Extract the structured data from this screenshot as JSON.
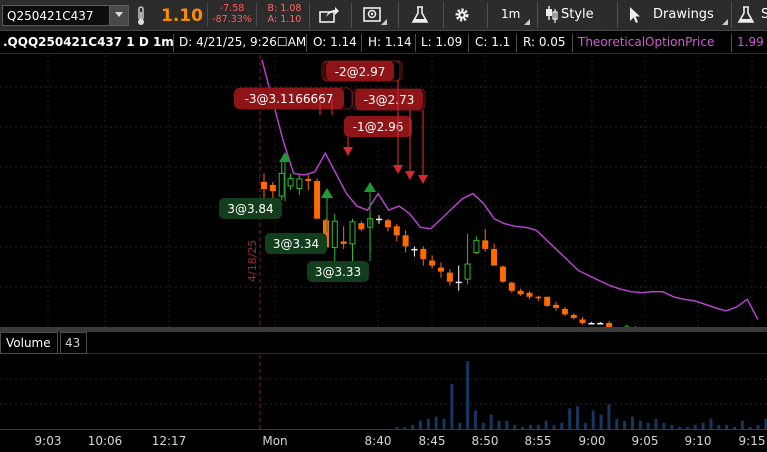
{
  "toolbar": {
    "symbol": "Q250421C437",
    "last_price": "1.10",
    "net_change": "-7.58",
    "pct_change": "-87.33%",
    "bid": "B: 1.08",
    "ask": "A: 1.10",
    "timeframe_label": "1m",
    "style_label": "Style",
    "drawings_label": "Drawings",
    "studies_label_partial": "S"
  },
  "infobar": {
    "title": ".QQQ250421C437 1 D 1m",
    "date": "D: 4/21/25, 9:26☐AM",
    "open": "O: 1.14",
    "high": "H: 1.14",
    "low": "L: 1.09",
    "close": "C: 1.1",
    "range": "R: 0.05",
    "study_name": "TheoreticalOptionPrice",
    "study_value": "1.99"
  },
  "colors": {
    "up": "#2dbb2d",
    "down": "#ff6a00",
    "neutral": "#ffffff",
    "theoretical_line": "#c044d6",
    "sell_label_bg": "#8e1417",
    "buy_label_bg": "#123e1e",
    "volume_bar": "#15375f"
  },
  "date_marker": "4/18/25",
  "trade_labels": [
    {
      "text": "-2@2.97",
      "side": "sell"
    },
    {
      "text": "-3@3.1166667",
      "side": "sell"
    },
    {
      "text": "-3@2.73",
      "side": "sell"
    },
    {
      "text": "-1@2.96",
      "side": "sell"
    },
    {
      "text": "3@3.84",
      "side": "buy"
    },
    {
      "text": "3@3.34",
      "side": "buy"
    },
    {
      "text": "3@3.33",
      "side": "buy"
    }
  ],
  "volume": {
    "label": "Volume",
    "value": "43"
  },
  "time_axis": [
    "9:03",
    "10:06",
    "12:17",
    "Mon",
    "8:40",
    "8:45",
    "8:50",
    "8:55",
    "9:00",
    "9:05",
    "9:10",
    "9:15"
  ],
  "chart_data": {
    "type": "candlestick",
    "price_range": [
      0.9,
      6.3
    ],
    "candles": [
      {
        "o": 3.78,
        "h": 3.95,
        "l": 3.45,
        "c": 3.64
      },
      {
        "o": 3.72,
        "h": 3.78,
        "l": 3.45,
        "c": 3.6
      },
      {
        "o": 3.5,
        "h": 4.18,
        "l": 3.42,
        "c": 3.95
      },
      {
        "o": 3.7,
        "h": 3.95,
        "l": 3.62,
        "c": 3.85
      },
      {
        "o": 3.65,
        "h": 3.92,
        "l": 3.52,
        "c": 3.84
      },
      {
        "o": 3.84,
        "h": 3.92,
        "l": 3.62,
        "c": 3.8
      },
      {
        "o": 3.8,
        "h": 3.85,
        "l": 3.05,
        "c": 3.05
      },
      {
        "o": 3.02,
        "h": 3.05,
        "l": 2.4,
        "c": 2.48
      },
      {
        "o": 2.48,
        "h": 3.15,
        "l": 2.1,
        "c": 3.0
      },
      {
        "o": 2.6,
        "h": 2.9,
        "l": 2.45,
        "c": 2.55
      },
      {
        "o": 2.55,
        "h": 3.05,
        "l": 2.2,
        "c": 2.99
      },
      {
        "o": 2.96,
        "h": 3.0,
        "l": 2.8,
        "c": 2.84
      },
      {
        "o": 2.88,
        "h": 3.1,
        "l": 2.4,
        "c": 3.05
      },
      {
        "o": 3.05,
        "h": 3.12,
        "l": 2.95,
        "c": 3.05
      },
      {
        "o": 3.02,
        "h": 3.05,
        "l": 2.8,
        "c": 2.88
      },
      {
        "o": 2.9,
        "h": 2.95,
        "l": 2.6,
        "c": 2.72
      },
      {
        "o": 2.72,
        "h": 2.82,
        "l": 2.38,
        "c": 2.5
      },
      {
        "o": 2.45,
        "h": 2.5,
        "l": 2.3,
        "c": 2.45
      },
      {
        "o": 2.45,
        "h": 2.5,
        "l": 2.12,
        "c": 2.25
      },
      {
        "o": 2.22,
        "h": 2.32,
        "l": 2.06,
        "c": 2.12
      },
      {
        "o": 2.08,
        "h": 2.18,
        "l": 1.88,
        "c": 2.0
      },
      {
        "o": 1.98,
        "h": 2.05,
        "l": 1.72,
        "c": 1.8
      },
      {
        "o": 1.8,
        "h": 2.12,
        "l": 1.62,
        "c": 1.8
      },
      {
        "o": 1.85,
        "h": 2.75,
        "l": 1.75,
        "c": 2.15
      },
      {
        "o": 2.38,
        "h": 2.7,
        "l": 2.35,
        "c": 2.62
      },
      {
        "o": 2.62,
        "h": 2.85,
        "l": 2.4,
        "c": 2.45
      },
      {
        "o": 2.45,
        "h": 2.55,
        "l": 2.12,
        "c": 2.12
      },
      {
        "o": 2.1,
        "h": 2.12,
        "l": 1.78,
        "c": 1.8
      },
      {
        "o": 1.78,
        "h": 1.8,
        "l": 1.58,
        "c": 1.62
      },
      {
        "o": 1.62,
        "h": 1.66,
        "l": 1.52,
        "c": 1.55
      },
      {
        "o": 1.58,
        "h": 1.62,
        "l": 1.45,
        "c": 1.5
      },
      {
        "o": 1.5,
        "h": 1.52,
        "l": 1.42,
        "c": 1.48
      },
      {
        "o": 1.5,
        "h": 1.5,
        "l": 1.3,
        "c": 1.32
      },
      {
        "o": 1.34,
        "h": 1.4,
        "l": 1.22,
        "c": 1.28
      },
      {
        "o": 1.26,
        "h": 1.3,
        "l": 1.12,
        "c": 1.15
      },
      {
        "o": 1.14,
        "h": 1.17,
        "l": 1.05,
        "c": 1.08
      },
      {
        "o": 1.05,
        "h": 1.1,
        "l": 0.95,
        "c": 0.98
      },
      {
        "o": 0.98,
        "h": 1.0,
        "l": 0.98,
        "c": 0.98
      },
      {
        "o": 0.98,
        "h": 1.0,
        "l": 0.96,
        "c": 0.98
      },
      {
        "o": 0.98,
        "h": 1.02,
        "l": 0.82,
        "c": 0.86
      },
      {
        "o": 0.86,
        "h": 0.88,
        "l": 0.82,
        "c": 0.82
      },
      {
        "o": 0.82,
        "h": 0.95,
        "l": 0.8,
        "c": 0.9
      },
      {
        "o": 0.88,
        "h": 0.92,
        "l": 0.76,
        "c": 0.8
      },
      {
        "o": 0.8,
        "h": 0.82,
        "l": 0.72,
        "c": 0.74
      },
      {
        "o": 0.72,
        "h": 0.74,
        "l": 0.7,
        "c": 0.72
      },
      {
        "o": 0.72,
        "h": 0.74,
        "l": 0.64,
        "c": 0.68
      },
      {
        "o": 0.68,
        "h": 0.72,
        "l": 0.62,
        "c": 0.66
      },
      {
        "o": 0.66,
        "h": 0.72,
        "l": 0.64,
        "c": 0.7
      },
      {
        "o": 0.66,
        "h": 0.72,
        "l": 0.64,
        "c": 0.7
      },
      {
        "o": 0.7,
        "h": 0.8,
        "l": 0.68,
        "c": 0.74
      },
      {
        "o": 0.72,
        "h": 0.76,
        "l": 0.66,
        "c": 0.72
      },
      {
        "o": 0.72,
        "h": 0.82,
        "l": 0.7,
        "c": 0.78
      },
      {
        "o": 0.7,
        "h": 0.84,
        "l": 0.68,
        "c": 0.78
      },
      {
        "o": 0.78,
        "h": 0.8,
        "l": 0.76,
        "c": 0.78
      },
      {
        "o": 0.76,
        "h": 0.8,
        "l": 0.64,
        "c": 0.68
      },
      {
        "o": 0.7,
        "h": 0.72,
        "l": 0.64,
        "c": 0.66
      },
      {
        "o": 0.66,
        "h": 0.7,
        "l": 0.62,
        "c": 0.64
      }
    ],
    "theoretical_price": [
      6.2,
      5.4,
      4.6,
      3.95,
      3.92,
      3.98,
      4.35,
      3.95,
      3.55,
      3.3,
      3.22,
      3.55,
      3.22,
      3.3,
      3.15,
      2.88,
      2.85,
      3.05,
      3.25,
      3.45,
      3.55,
      3.35,
      3.05,
      2.95,
      2.9,
      2.88,
      2.82,
      2.62,
      2.42,
      2.22,
      2.02,
      1.92,
      1.82,
      1.72,
      1.65,
      1.6,
      1.58,
      1.6,
      1.6,
      1.5,
      1.45,
      1.42,
      1.35,
      1.28,
      1.22,
      1.3,
      1.45,
      1.05
    ],
    "volume": [
      0,
      0,
      0,
      0,
      0,
      0,
      0,
      0,
      0,
      0,
      0,
      0,
      0,
      0,
      0,
      0,
      0,
      1,
      1,
      2,
      4,
      5,
      6,
      5,
      22,
      3,
      33,
      9,
      3,
      7,
      4,
      4,
      2,
      1,
      2,
      2,
      4,
      2,
      3,
      10,
      11,
      3,
      9,
      7,
      12,
      5,
      4,
      6,
      4,
      3,
      5,
      3,
      2,
      1,
      1,
      2,
      3,
      5,
      2,
      2,
      1,
      4,
      1,
      2,
      5
    ]
  }
}
